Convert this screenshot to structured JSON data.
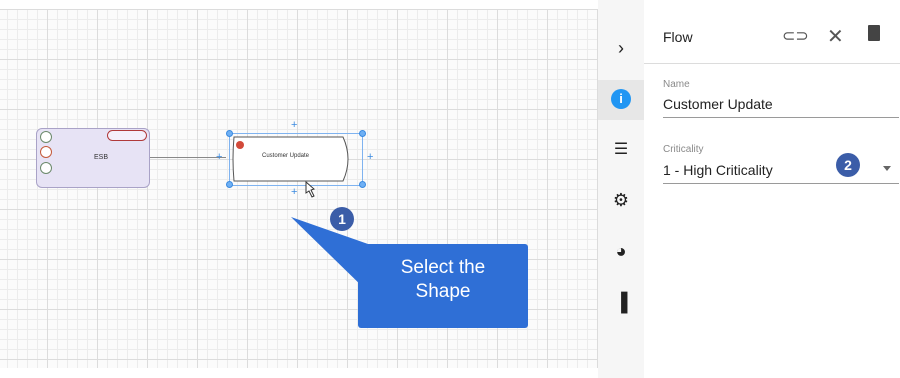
{
  "canvas": {
    "esb_node": {
      "label": "ESB"
    },
    "flow_node": {
      "label": "Customer Update"
    },
    "callout": {
      "text_line1": "Select the",
      "text_line2": "Shape",
      "step": "1"
    }
  },
  "panel": {
    "title": "Flow",
    "fields": [
      {
        "label": "Name",
        "value": "Customer Update"
      },
      {
        "label": "Criticality",
        "value": "1 - High Criticality"
      }
    ],
    "step_badge": "2",
    "rail_icons": [
      "chevron-right-icon",
      "info-icon",
      "list-icon",
      "gear-icon",
      "palette-icon",
      "delete-icon"
    ],
    "header_icons": [
      "link-icon",
      "close-icon",
      "trash-icon"
    ]
  },
  "colors": {
    "accent_blue": "#3b5da8",
    "callout_blue": "#2f6fd6",
    "info_blue": "#2196f3"
  }
}
